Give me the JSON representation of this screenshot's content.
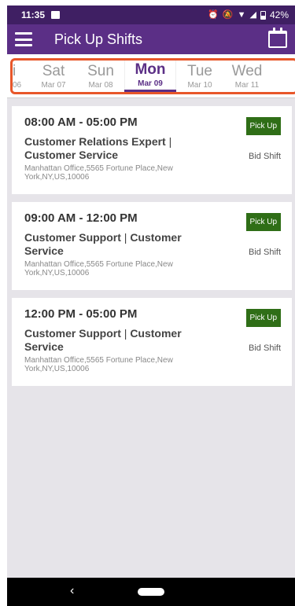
{
  "status_bar": {
    "time": "11:35",
    "battery": "42%"
  },
  "app_bar": {
    "title": "Pick Up Shifts"
  },
  "days": [
    {
      "name": "i",
      "date": "06"
    },
    {
      "name": "Sat",
      "date": "Mar 07"
    },
    {
      "name": "Sun",
      "date": "Mar 08"
    },
    {
      "name": "Mon",
      "date": "Mar 09"
    },
    {
      "name": "Tue",
      "date": "Mar 10"
    },
    {
      "name": "Wed",
      "date": "Mar 11"
    }
  ],
  "shifts": [
    {
      "time": "08:00 AM - 05:00 PM",
      "role": "Customer Relations Expert",
      "department": "Customer Service",
      "address": "Manhattan Office,5565 Fortune Place,New York,NY,US,10006",
      "pickup_label": "Pick Up",
      "bid_label": "Bid Shift"
    },
    {
      "time": "09:00 AM - 12:00 PM",
      "role": "Customer Support",
      "department": "Customer Service",
      "address": "Manhattan Office,5565 Fortune Place,New York,NY,US,10006",
      "pickup_label": "Pick Up",
      "bid_label": "Bid Shift"
    },
    {
      "time": "12:00 PM - 05:00 PM",
      "role": "Customer Support",
      "department": "Customer Service",
      "address": "Manhattan Office,5565 Fortune Place,New York,NY,US,10006",
      "pickup_label": "Pick Up",
      "bid_label": "Bid Shift"
    }
  ],
  "nav": {
    "back_glyph": "‹"
  },
  "colors": {
    "status_bar": "#3f1f63",
    "app_bar": "#5b2f86",
    "accent": "#5b2f86",
    "highlight": "#e8572a",
    "pickup_button": "#2f6e17",
    "list_background": "#e6e4e9"
  }
}
